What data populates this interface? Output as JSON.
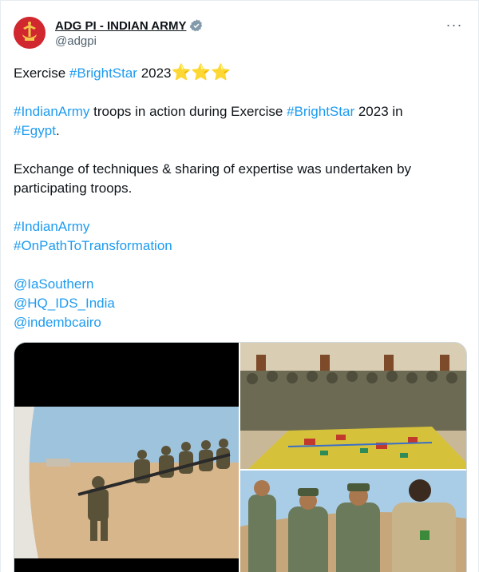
{
  "author": {
    "display_name": "ADG PI - INDIAN ARMY",
    "handle": "@adgpi",
    "verified_icon": "verified-badge-icon",
    "avatar_icon": "indian-army-emblem-icon"
  },
  "more_icon": "more-options-icon",
  "tweet": {
    "line1_text": "Exercise ",
    "line1_tag": "#BrightStar",
    "line1_year": " 2023",
    "line1_stars": "⭐⭐⭐",
    "para2_tag1": "#IndianArmy",
    "para2_mid": " troops in action during Exercise ",
    "para2_tag2": "#BrightStar",
    "para2_end": " 2023 in",
    "para2_tag3": "#Egypt",
    "para2_dot": ".",
    "para3": "Exchange of techniques & sharing of expertise was undertaken by participating troops.",
    "hashtags": [
      "#IndianArmy",
      "#OnPathToTransformation"
    ],
    "mentions": [
      "@IaSouthern",
      "@HQ_IDS_India",
      "@indembcairo"
    ]
  },
  "colors": {
    "link": "#1d9bf0",
    "text": "#0f1419",
    "muted": "#536471",
    "border": "#cfd9de"
  }
}
